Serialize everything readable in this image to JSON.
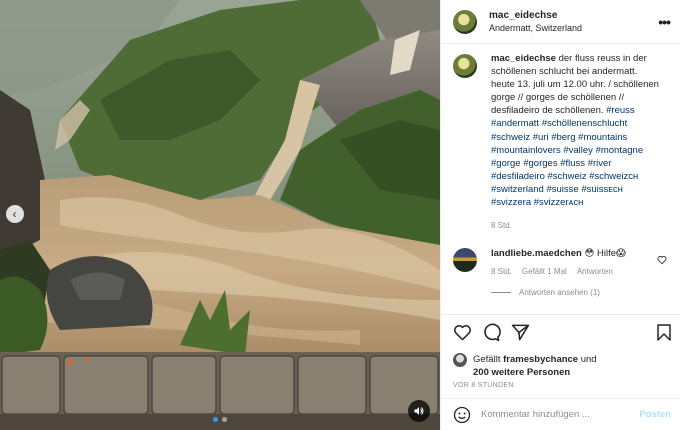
{
  "post": {
    "username": "mac_eidechse",
    "location": "Andermatt, Switzerland",
    "more_icon": "ellipsis-icon",
    "caption": {
      "username": "mac_eidechse",
      "text": "der fluss reuss in der schöllenen schlucht bei andermatt. heute 13. juli um 12.00 uhr. / schöllenen gorge // gorges de schöllenen // desfiladeiro de schöllenen.",
      "hashtags": [
        "#reuss",
        "#andermatt",
        "#schöllenenschlucht",
        "#schweiz",
        "#uri",
        "#berg",
        "#mountains",
        "#mountainlovers",
        "#valley",
        "#montagne",
        "#gorge",
        "#gorges",
        "#fluss",
        "#river",
        "#desfiladeiro",
        "#schweiz",
        "#schweizᴄʜ",
        "#switzerland",
        "#suisse",
        "#suissᴇᴄʜ",
        "#svizzera",
        "#svizzerᴀᴄʜ"
      ],
      "time": "8 Std."
    },
    "comment": {
      "username": "landliebe.maedchen",
      "text": "😳 Hilfe😱",
      "time": "8 Std.",
      "likes": "Gefällt 1 Mal",
      "reply": "Antworten",
      "view_replies": "Antworten ansehen (1)"
    },
    "likes": {
      "prefix": "Gefällt",
      "user": "framesbychance",
      "and": "und",
      "others": "200 weitere Personen"
    },
    "date": "VOR 8 STUNDEN",
    "add_comment": {
      "placeholder": "Kommentar hinzufügen ...",
      "post_label": "Posten"
    }
  },
  "colors": {
    "accent": "#3897f0",
    "hashtag": "#00376b",
    "muted": "#8e8e8e",
    "post_button_disabled": "#b2dffc"
  }
}
